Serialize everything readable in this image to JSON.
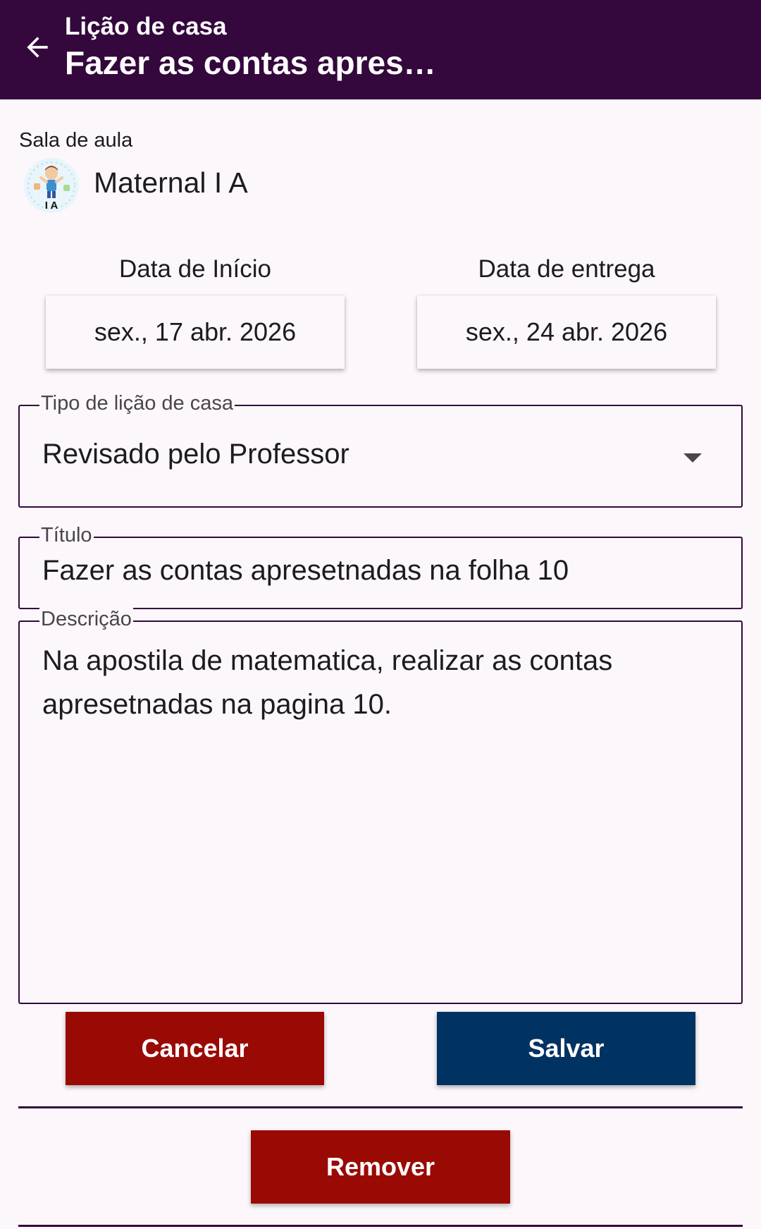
{
  "appbar": {
    "subtitle": "Lição de casa",
    "title": "Fazer as contas apres…"
  },
  "classroom": {
    "label": "Sala de aula",
    "name": "Maternal I A",
    "avatar_text": "I A"
  },
  "dates": {
    "start_label": "Data de Início",
    "start_value": "sex., 17 abr. 2026",
    "due_label": "Data de entrega",
    "due_value": "sex., 24 abr. 2026"
  },
  "homework_type": {
    "label": "Tipo de lição de casa",
    "value": "Revisado pelo Professor"
  },
  "title_field": {
    "label": "Título",
    "value": "Fazer as contas apresetnadas na folha 10"
  },
  "description_field": {
    "label": "Descrição",
    "value": "Na apostila de matematica, realizar as contas apresetnadas na pagina 10."
  },
  "buttons": {
    "cancel": "Cancelar",
    "save": "Salvar",
    "remove": "Remover"
  },
  "colors": {
    "appbar": "#34073d",
    "danger": "#9a0a05",
    "primary": "#003262",
    "background": "#fcf7fa"
  }
}
